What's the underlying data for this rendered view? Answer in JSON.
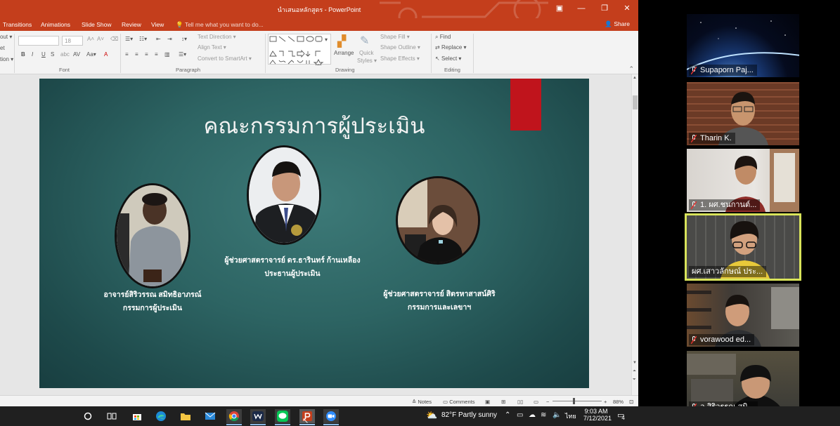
{
  "window": {
    "title": "นำเสนอหลักสูตร - PowerPoint",
    "controls": {
      "ribbon_options": "▣",
      "minimize": "—",
      "restore": "❐",
      "close": "✕"
    }
  },
  "tabs": [
    "Transitions",
    "Animations",
    "Slide Show",
    "Review",
    "View"
  ],
  "tell_me": "Tell me what you want to do...",
  "share": "Share",
  "ribbon": {
    "partial_left": [
      "out ▾",
      "et",
      "tion ▾"
    ],
    "font": {
      "size": "18",
      "label": "Font"
    },
    "paragraph": {
      "text_direction": "Text Direction ▾",
      "align_text": "Align Text ▾",
      "convert_smartart": "Convert to SmartArt ▾",
      "label": "Paragraph"
    },
    "drawing": {
      "arrange": "Arrange",
      "quick_styles_1": "Quick",
      "quick_styles_2": "Styles ▾",
      "shape_fill": "Shape Fill ▾",
      "shape_outline": "Shape Outline ▾",
      "shape_effects": "Shape Effects ▾",
      "label": "Drawing"
    },
    "editing": {
      "find": "Find",
      "replace": "Replace ▾",
      "select": "Select ▾",
      "label": "Editing"
    }
  },
  "slide": {
    "title": "คณะกรรมการผู้ประเมิน",
    "people": [
      {
        "name": "อาจารย์สิริวรรณ สมิทธิอาภรณ์",
        "role": "กรรมการผู้ประเมิน"
      },
      {
        "name": "ผู้ช่วยศาสตราจารย์ ดร.ธารินทร์ ก้านเหลือง",
        "role": "ประธานผู้ประเมิน"
      },
      {
        "name": "ผู้ช่วยศาสตราจารย์ สิตรหาสาสน์ศิริ",
        "role": "กรรมการและเลขาฯ"
      }
    ]
  },
  "statusbar": {
    "notes": "Notes",
    "comments": "Comments",
    "zoom_minus": "−",
    "zoom_plus": "+",
    "zoom_level": "88%",
    "zoom_fraction": 0.44
  },
  "participants": [
    {
      "name": "Supaporn Paj..."
    },
    {
      "name": "Tharin K."
    },
    {
      "name": "1. ผศ.ชนกานต์..."
    },
    {
      "name": "ผศ.เสาวลักษณ์ ประ..."
    },
    {
      "name": "vorawood ed..."
    },
    {
      "name": "อ.สิริวรรณ สมิ..."
    }
  ],
  "taskbar": {
    "weather": "82°F  Partly sunny",
    "language": "ไทย",
    "time": "9:03 AM",
    "date": "7/12/2021",
    "notification_count": "4"
  }
}
